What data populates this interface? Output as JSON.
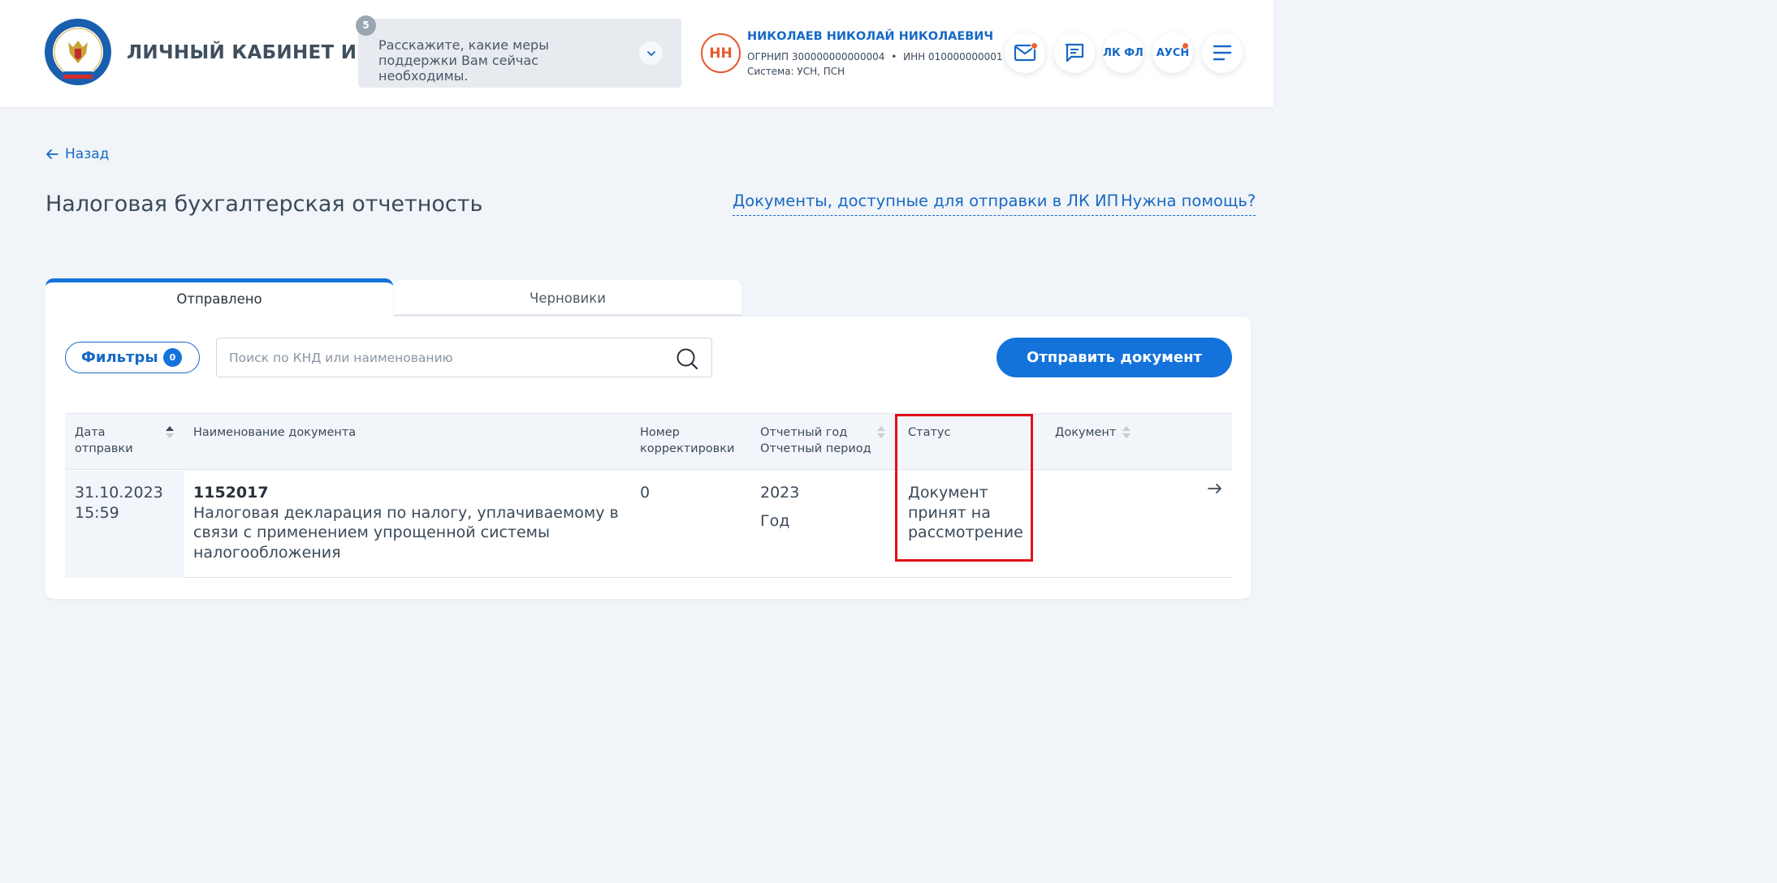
{
  "header": {
    "app_title": "ЛИЧНЫЙ КАБИНЕТ ИП",
    "logo_name": "fns-emblem",
    "survey": {
      "badge": "5",
      "text": "Расскажите, какие меры поддержки Вам сейчас необходимы."
    },
    "user": {
      "initials": "НН",
      "name": "НИКОЛАЕВ НИКОЛАЙ НИКОЛАЕВИЧ",
      "ogrnip": "ОГРНИП 300000000000004",
      "separator": "•",
      "inn": "ИНН 010000000001",
      "system": "Система: УСН, ПСН"
    },
    "buttons": {
      "mail_icon": "mail-icon",
      "messages_icon": "chat-icon",
      "lk_fl": "ЛК ФЛ",
      "ausn": "АУСН",
      "menu_icon": "menu-icon"
    },
    "notification_color": "#f0622f"
  },
  "page": {
    "back": "Назад",
    "title": "Налоговая бухгалтерская отчетность",
    "links": {
      "documents": "Документы, доступные для отправки в ЛК ИП",
      "help": "Нужна помощь?"
    },
    "tabs": [
      {
        "label": "Отправлено",
        "active": true
      },
      {
        "label": "Черновики",
        "active": false
      }
    ],
    "filters": {
      "label": "Фильтры",
      "count": "0"
    },
    "search": {
      "placeholder": "Поиск по КНД или наименованию",
      "value": ""
    },
    "send_button": "Отправить документ",
    "accent_color": "#1472db"
  },
  "table": {
    "columns": [
      {
        "line1": "Дата",
        "line2": "отправки",
        "sortable": true,
        "sort": "asc"
      },
      {
        "line1": "Наименование документа",
        "line2": "",
        "sortable": false
      },
      {
        "line1": "Номер",
        "line2": "корректировки",
        "sortable": false
      },
      {
        "line1": "Отчетный год",
        "line2": "Отчетный период",
        "sortable": true
      },
      {
        "line1": "Статус",
        "line2": "",
        "sortable": false
      },
      {
        "line1": "Документ",
        "line2": "",
        "sortable": true
      }
    ],
    "rows": [
      {
        "date": "31.10.2023",
        "time": "15:59",
        "knd": "1152017",
        "name_line1": "Налоговая декларация по налогу, уплачиваемому в",
        "name_line2": "связи с применением упрощенной системы",
        "name_line3": "налогообложения",
        "correction": "0",
        "year": "2023",
        "period": "Год",
        "status_line1": "Документ",
        "status_line2": "принят на",
        "status_line3": "рассмотрение",
        "document": ""
      }
    ],
    "highlight_color": "#e3101a"
  }
}
